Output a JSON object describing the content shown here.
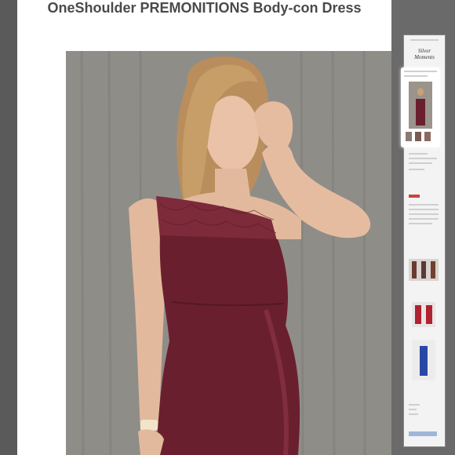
{
  "product": {
    "title": "OneShoulder PREMONITIONS Body-con Dress"
  },
  "photo": {
    "alt": "Model wearing burgundy one-shoulder lace body-con dress"
  },
  "sidebar_preview": {
    "logo_text": "Silver Moments"
  },
  "colors": {
    "dress": "#6a1f2e",
    "lace": "#7d2a3b",
    "background_wall": "#8f8d88",
    "accent_button": "#c9453c"
  },
  "icons": {
    "hand": "hand-icon"
  }
}
